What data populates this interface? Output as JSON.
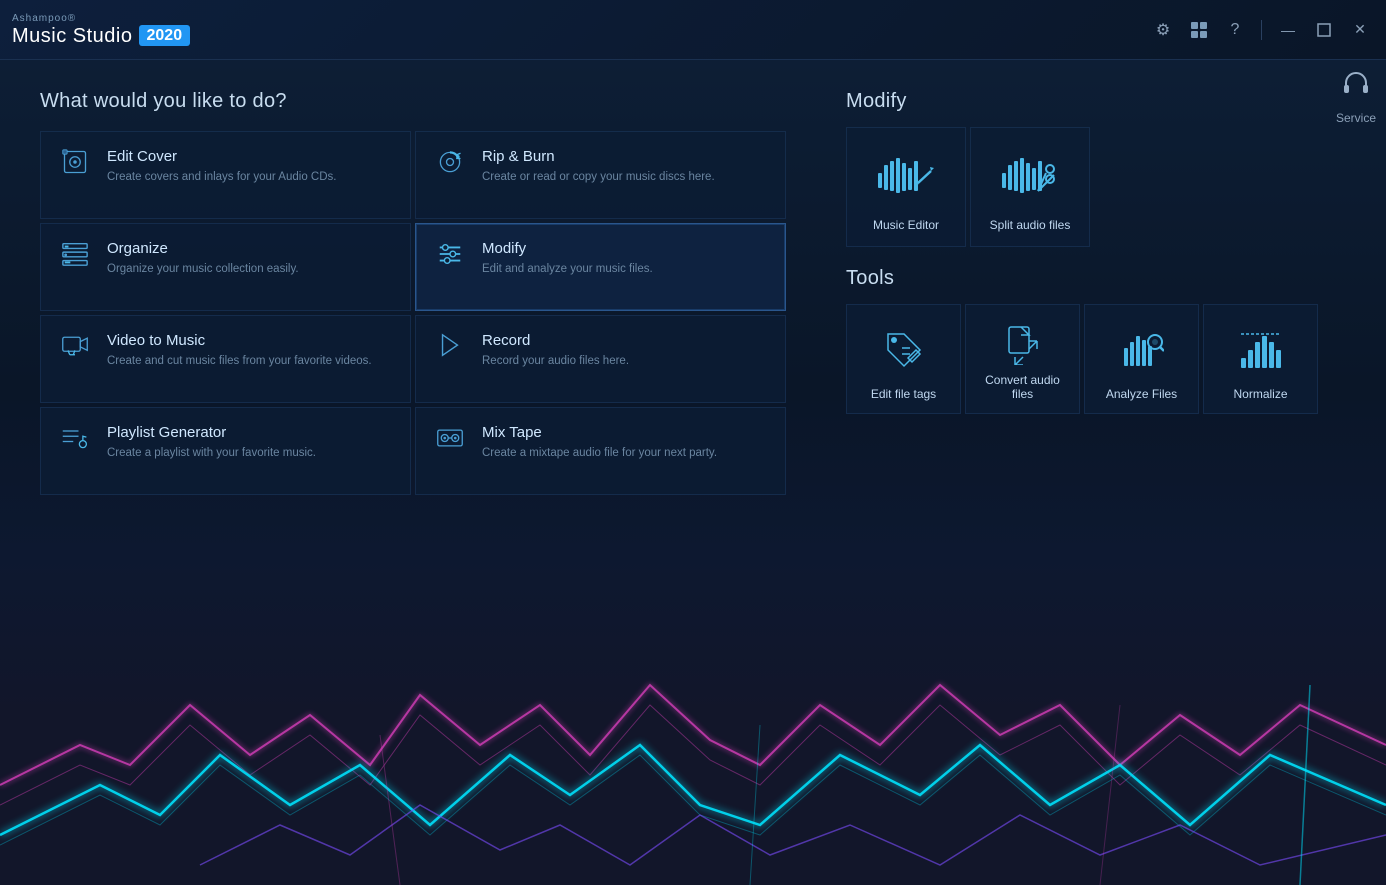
{
  "app": {
    "brand": "Ashampoo®",
    "title": "Music Studio",
    "badge": "2020"
  },
  "titlebar": {
    "controls": {
      "settings": "⚙",
      "theme": "🎨",
      "help": "?",
      "minimize": "—",
      "maximize": "🗖",
      "close": "✕"
    }
  },
  "service": {
    "label": "Service"
  },
  "leftSection": {
    "heading": "What would you like to do?",
    "cards": [
      {
        "id": "edit-cover",
        "title": "Edit Cover",
        "desc": "Create covers and inlays for your Audio CDs."
      },
      {
        "id": "rip-burn",
        "title": "Rip & Burn",
        "desc": "Create or read or copy your music discs here."
      },
      {
        "id": "organize",
        "title": "Organize",
        "desc": "Organize your music collection easily."
      },
      {
        "id": "modify",
        "title": "Modify",
        "desc": "Edit and analyze your music files.",
        "active": true
      },
      {
        "id": "video-to-music",
        "title": "Video to Music",
        "desc": "Create and cut music files from your favorite videos."
      },
      {
        "id": "record",
        "title": "Record",
        "desc": "Record your audio files here."
      },
      {
        "id": "playlist-generator",
        "title": "Playlist Generator",
        "desc": "Create a playlist with your favorite music."
      },
      {
        "id": "mix-tape",
        "title": "Mix Tape",
        "desc": "Create a mixtape audio file for your next party."
      }
    ]
  },
  "rightSection": {
    "modifyHeading": "Modify",
    "toolsHeading": "Tools",
    "modifyCards": [
      {
        "id": "music-editor",
        "label": "Music Editor"
      },
      {
        "id": "split-audio",
        "label": "Split audio files"
      }
    ],
    "toolCards": [
      {
        "id": "edit-file-tags",
        "label": "Edit file tags"
      },
      {
        "id": "convert-audio",
        "label": "Convert audio files"
      },
      {
        "id": "analyze-files",
        "label": "Analyze Files"
      },
      {
        "id": "normalize",
        "label": "Normalize"
      }
    ]
  }
}
